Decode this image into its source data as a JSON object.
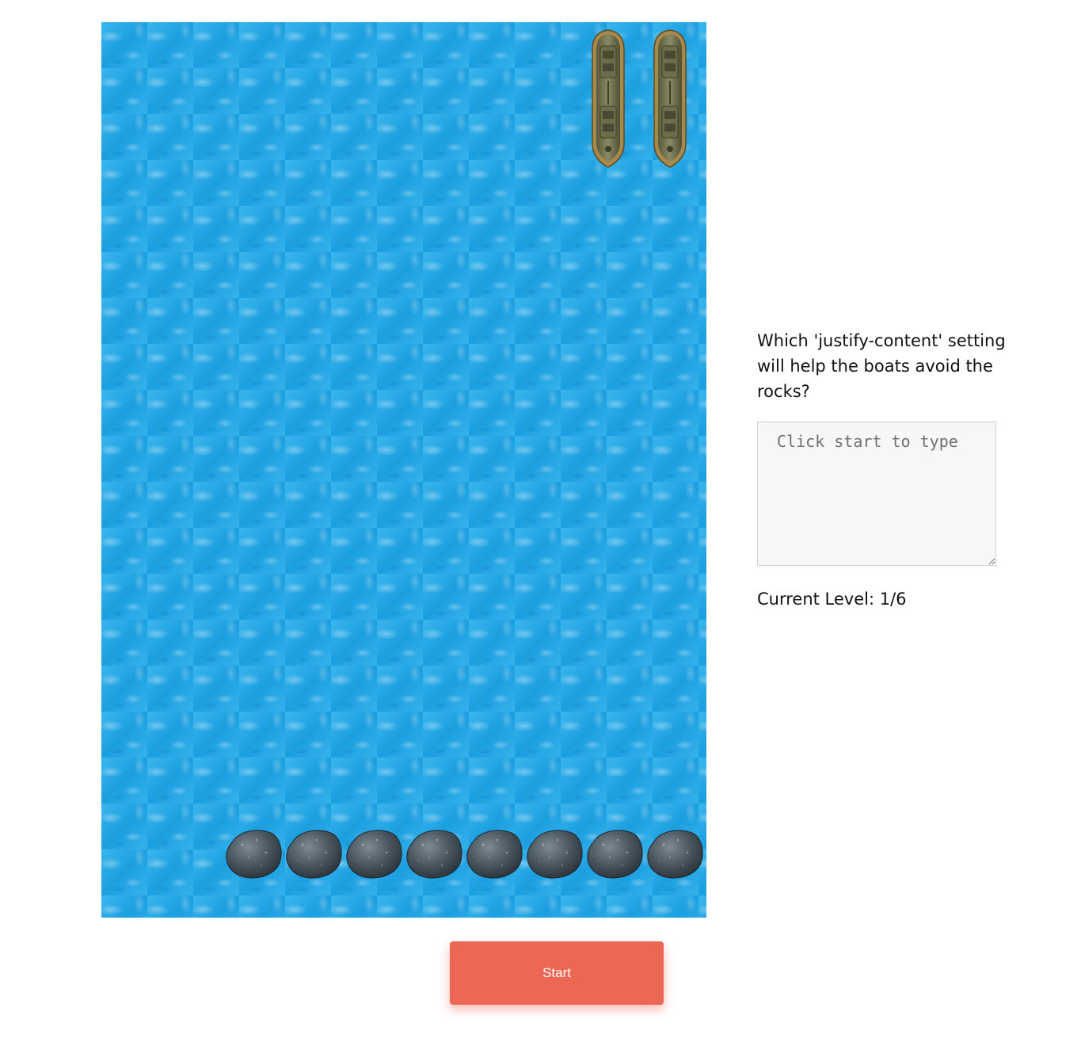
{
  "game": {
    "boat_count": 2,
    "rock_count": 8,
    "boat_icon": "boat-icon",
    "rock_icon": "rock-icon",
    "water_color": "#2aa8e6"
  },
  "panel": {
    "question": "Which 'justify-content' setting will help the boats avoid the rocks?",
    "answer_value": "",
    "answer_placeholder": "Click start to type",
    "level_text": "Current Level: 1/6"
  },
  "controls": {
    "start_label": "Start",
    "start_color": "#ed6755"
  }
}
